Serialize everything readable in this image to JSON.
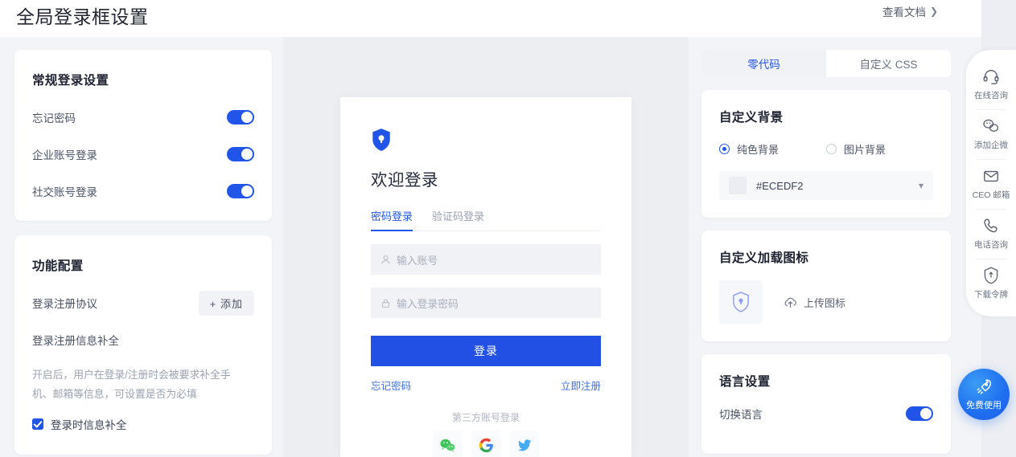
{
  "header": {
    "title": "全局登录框设置",
    "doc_link": "查看文档",
    "doc_chevron": "chevron-right-icon"
  },
  "left": {
    "general": {
      "title": "常规登录设置",
      "rows": [
        {
          "label": "忘记密码",
          "on": true
        },
        {
          "label": "企业账号登录",
          "on": true
        },
        {
          "label": "社交账号登录",
          "on": true
        }
      ]
    },
    "functions": {
      "title": "功能配置",
      "protocol_label": "登录注册协议",
      "add_button": "+ 添加",
      "supplement_label": "登录注册信息补全",
      "description": "开启后，用户在登录/注册时会被要求补全手机、邮箱等信息，可设置是否为必填",
      "checkbox_label": "登录时信息补全",
      "checkbox_checked": true
    }
  },
  "preview": {
    "background_color": "#ECEDF2",
    "brand_icon": "shield-lock-icon",
    "welcome": "欢迎登录",
    "tabs": [
      {
        "label": "密码登录",
        "active": true
      },
      {
        "label": "验证码登录",
        "active": false
      }
    ],
    "fields": [
      {
        "icon": "user-icon",
        "placeholder": "输入账号",
        "value": ""
      },
      {
        "icon": "lock-icon",
        "placeholder": "输入登录密码",
        "value": ""
      }
    ],
    "submit": "登录",
    "forgot_password": "忘记密码",
    "register_now": "立即注册",
    "third_party_label": "第三方账号登录",
    "social": [
      {
        "name": "wechat-icon",
        "label": "微信"
      },
      {
        "name": "google-icon",
        "label": "Google"
      },
      {
        "name": "twitter-icon",
        "label": "Twitter"
      }
    ]
  },
  "right": {
    "tabs": [
      {
        "label": "零代码",
        "active": true
      },
      {
        "label": "自定义 CSS",
        "active": false
      }
    ],
    "background": {
      "title": "自定义背景",
      "options": [
        {
          "label": "纯色背景",
          "selected": true
        },
        {
          "label": "图片背景",
          "selected": false
        }
      ],
      "color_value": "#ECEDF2",
      "chevron": "chevron-down-icon"
    },
    "loading_icon": {
      "title": "自定义加载图标",
      "thumb_icon": "shield-lock-icon",
      "upload_label": "上传图标",
      "upload_icon": "cloud-upload-icon"
    },
    "language": {
      "title": "语言设置",
      "row_label": "切换语言",
      "row_on": true
    }
  },
  "dock": {
    "items": [
      {
        "icon": "headset-icon",
        "label": "在线咨询"
      },
      {
        "icon": "wechat-work-icon",
        "label": "添加企微"
      },
      {
        "icon": "mail-icon",
        "label": "CEO 邮箱"
      },
      {
        "icon": "phone-icon",
        "label": "电话咨询"
      },
      {
        "icon": "shield-download-icon",
        "label": "下载令牌"
      }
    ],
    "fab": {
      "icon": "rocket-icon",
      "label": "免费使用"
    }
  },
  "colors": {
    "accent": "#2154E8",
    "surface": "#F3F4F7",
    "preview_bg": "#ECEEF2"
  }
}
